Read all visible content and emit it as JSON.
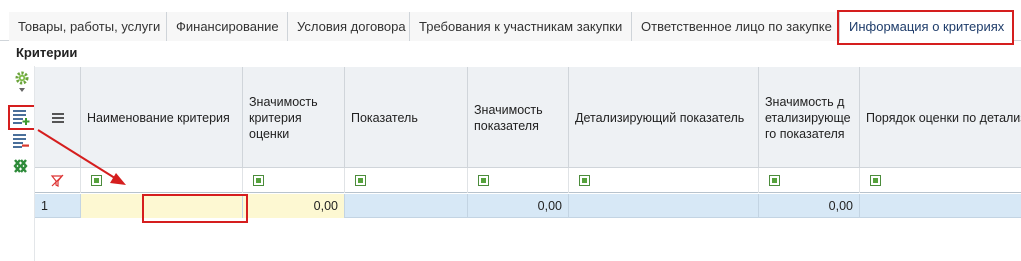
{
  "tabs": [
    {
      "label": "Товары, работы, услуги"
    },
    {
      "label": "Финансирование"
    },
    {
      "label": "Условия договора"
    },
    {
      "label": "Требования к участникам закупки"
    },
    {
      "label": "Ответственное лицо по закупке"
    },
    {
      "label": "Информация о критериях"
    }
  ],
  "active_tab": "Информация о критериях",
  "section_title": "Критерии",
  "toolbar": {
    "icons": [
      "settings-gear-icon",
      "dropdown-arrow-icon",
      "add-row-icon",
      "delete-row-icon",
      "excel-export-icon"
    ]
  },
  "grid": {
    "columns": [
      {
        "label": ""
      },
      {
        "label": "Наименование критерия"
      },
      {
        "label": "Значимость критерия оценки"
      },
      {
        "label": "Показатель"
      },
      {
        "label": "Значимость показателя"
      },
      {
        "label": "Детализирующий показатель"
      },
      {
        "label": "Значимость детализирующего показателя"
      },
      {
        "label": "Порядок оценки по детализирующему показателю"
      }
    ],
    "rows": [
      {
        "num": "1",
        "criterion_name": "",
        "criterion_weight": "0,00",
        "indicator": "",
        "indicator_weight": "0,00",
        "detail_indicator": "",
        "detail_weight": "0,00",
        "order": ""
      }
    ]
  },
  "colors": {
    "highlight": "#d51e1e",
    "active_tab_text": "#1f3d6b",
    "selected_row": "#d7e8f6",
    "editable_cell": "#fdf8d2"
  }
}
